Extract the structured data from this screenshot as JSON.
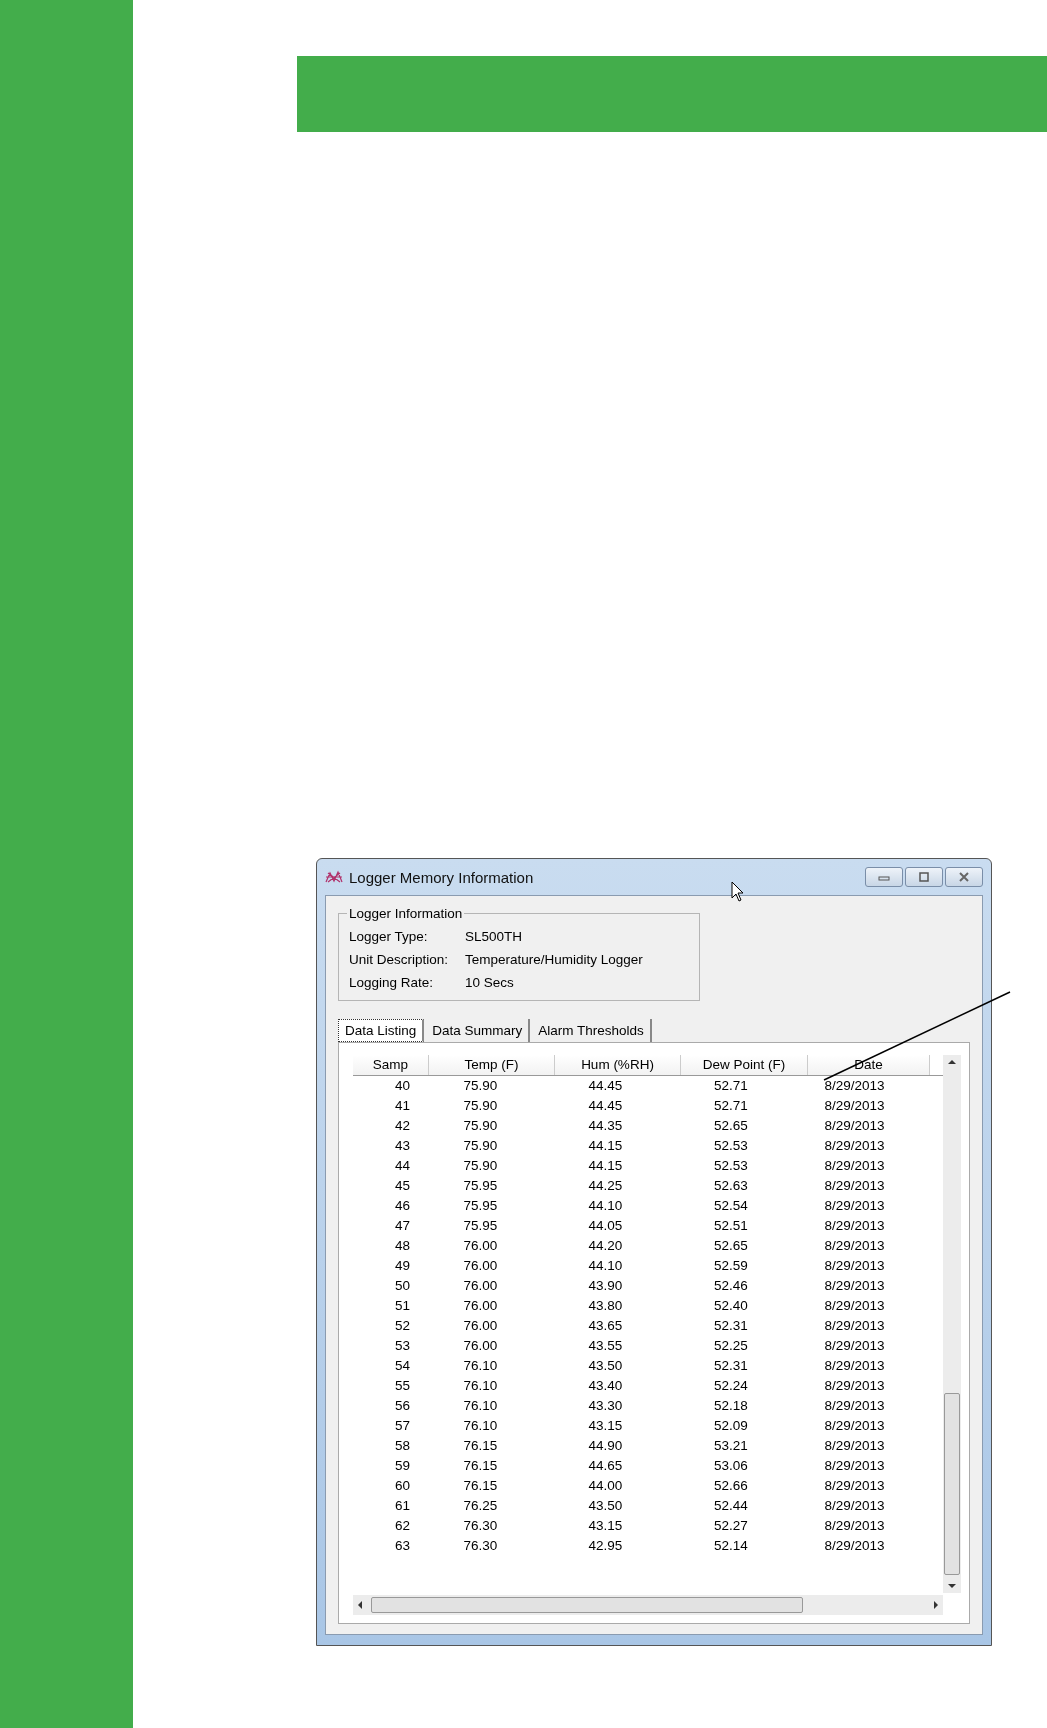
{
  "window": {
    "title": "Logger Memory Information"
  },
  "logger_information": {
    "title": "Logger Information",
    "fields": [
      {
        "label": "Logger Type:",
        "value": "SL500TH"
      },
      {
        "label": "Unit Description:",
        "value": "Temperature/Humidity Logger"
      },
      {
        "label": "Logging Rate:",
        "value": "10 Secs"
      }
    ]
  },
  "tabs": [
    {
      "label": "Data Listing",
      "selected": true
    },
    {
      "label": "Data Summary",
      "selected": false
    },
    {
      "label": "Alarm Thresholds",
      "selected": false
    }
  ],
  "table": {
    "columns": [
      "Samp",
      "Temp (F)",
      "Hum (%RH)",
      "Dew Point (F)",
      "Date"
    ],
    "rows": [
      [
        "40",
        "75.90",
        "44.45",
        "52.71",
        "8/29/2013"
      ],
      [
        "41",
        "75.90",
        "44.45",
        "52.71",
        "8/29/2013"
      ],
      [
        "42",
        "75.90",
        "44.35",
        "52.65",
        "8/29/2013"
      ],
      [
        "43",
        "75.90",
        "44.15",
        "52.53",
        "8/29/2013"
      ],
      [
        "44",
        "75.90",
        "44.15",
        "52.53",
        "8/29/2013"
      ],
      [
        "45",
        "75.95",
        "44.25",
        "52.63",
        "8/29/2013"
      ],
      [
        "46",
        "75.95",
        "44.10",
        "52.54",
        "8/29/2013"
      ],
      [
        "47",
        "75.95",
        "44.05",
        "52.51",
        "8/29/2013"
      ],
      [
        "48",
        "76.00",
        "44.20",
        "52.65",
        "8/29/2013"
      ],
      [
        "49",
        "76.00",
        "44.10",
        "52.59",
        "8/29/2013"
      ],
      [
        "50",
        "76.00",
        "43.90",
        "52.46",
        "8/29/2013"
      ],
      [
        "51",
        "76.00",
        "43.80",
        "52.40",
        "8/29/2013"
      ],
      [
        "52",
        "76.00",
        "43.65",
        "52.31",
        "8/29/2013"
      ],
      [
        "53",
        "76.00",
        "43.55",
        "52.25",
        "8/29/2013"
      ],
      [
        "54",
        "76.10",
        "43.50",
        "52.31",
        "8/29/2013"
      ],
      [
        "55",
        "76.10",
        "43.40",
        "52.24",
        "8/29/2013"
      ],
      [
        "56",
        "76.10",
        "43.30",
        "52.18",
        "8/29/2013"
      ],
      [
        "57",
        "76.10",
        "43.15",
        "52.09",
        "8/29/2013"
      ],
      [
        "58",
        "76.15",
        "44.90",
        "53.21",
        "8/29/2013"
      ],
      [
        "59",
        "76.15",
        "44.65",
        "53.06",
        "8/29/2013"
      ],
      [
        "60",
        "76.15",
        "44.00",
        "52.66",
        "8/29/2013"
      ],
      [
        "61",
        "76.25",
        "43.50",
        "52.44",
        "8/29/2013"
      ],
      [
        "62",
        "76.30",
        "43.15",
        "52.27",
        "8/29/2013"
      ],
      [
        "63",
        "76.30",
        "42.95",
        "52.14",
        "8/29/2013"
      ]
    ]
  }
}
